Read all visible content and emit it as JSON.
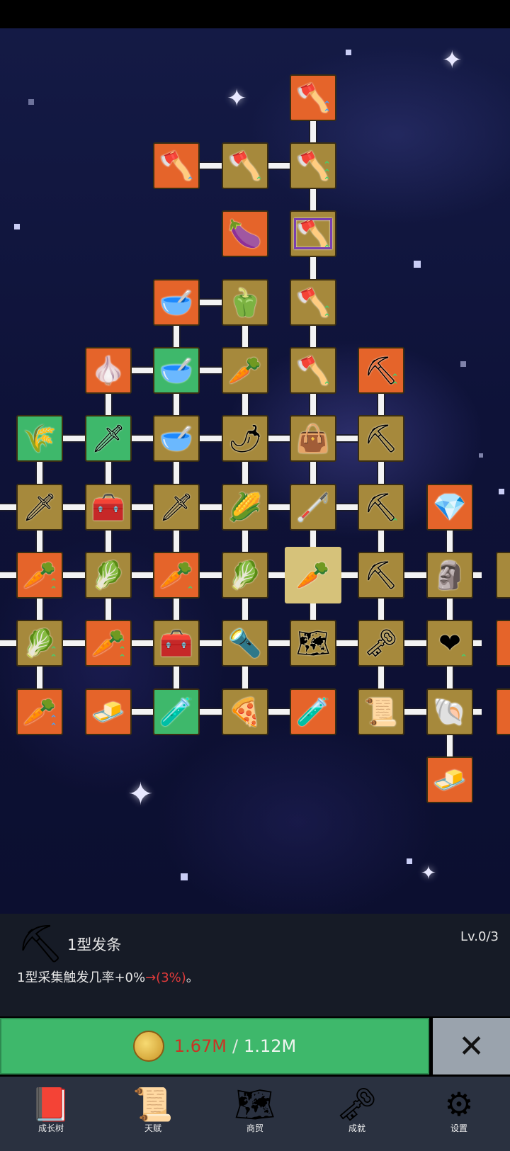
{
  "selected": {
    "icon": "pickaxe-icon",
    "name": "1型发条",
    "level": "Lv.0/3",
    "desc_prefix": "1型采集触发几率+0%",
    "desc_next": "→(3%)",
    "desc_suffix": "。"
  },
  "upgrade": {
    "current": "1.67M",
    "separator": "/",
    "required": "1.12M",
    "coin_icon": "gold-coin-icon"
  },
  "close_label": "✕",
  "nav": [
    {
      "label": "成长树",
      "icon": "book-icon",
      "glyph": "📕"
    },
    {
      "label": "天赋",
      "icon": "scroll-icon",
      "glyph": "📜"
    },
    {
      "label": "商贸",
      "icon": "map-icon",
      "glyph": "🗺"
    },
    {
      "label": "成就",
      "icon": "key-icon",
      "glyph": "🗝"
    },
    {
      "label": "设置",
      "icon": "gear-icon",
      "glyph": "⚙"
    }
  ],
  "colors": {
    "gold_tile": "#a6893c",
    "orange_tile": "#e5642a",
    "green_tile": "#3eb86b",
    "button_green": "#3eb86b",
    "warning_red": "#e23b3b"
  },
  "tree": [
    {
      "id": "shovel-top",
      "icon": "shovel-icon",
      "glyph": "🪓",
      "style": "orange",
      "up": "^^",
      "upColor": "blue"
    },
    {
      "id": "shovel-left",
      "icon": "shovel-icon",
      "glyph": "🪓",
      "style": "orange",
      "up": "^",
      "upColor": "blue"
    },
    {
      "id": "shovel-red",
      "icon": "shovel-icon",
      "glyph": "🪓",
      "style": "gold",
      "up": "^",
      "upColor": "green"
    },
    {
      "id": "shovel-mid",
      "icon": "shovel-icon",
      "glyph": "🪓",
      "style": "gold",
      "up": "^^^",
      "upColor": "green"
    },
    {
      "id": "eggplant",
      "icon": "eggplant-icon",
      "glyph": "🍆",
      "style": "orange"
    },
    {
      "id": "shovel-purple",
      "icon": "shovel-icon",
      "glyph": "🪓",
      "style": "purple",
      "up": "^",
      "upColor": "green"
    },
    {
      "id": "bowl-1",
      "icon": "bowl-icon",
      "glyph": "🥣",
      "style": "orange"
    },
    {
      "id": "pepper-green",
      "icon": "bell-pepper-icon",
      "glyph": "🫑",
      "style": "gold"
    },
    {
      "id": "shovel-4",
      "icon": "shovel-icon",
      "glyph": "🪓",
      "style": "gold",
      "up": "^^",
      "upColor": "green"
    },
    {
      "id": "garlic",
      "icon": "garlic-icon",
      "glyph": "🧄",
      "style": "orange"
    },
    {
      "id": "bowl-2",
      "icon": "bowl-icon",
      "glyph": "🥣",
      "style": "green"
    },
    {
      "id": "radish",
      "icon": "radish-icon",
      "glyph": "🥕",
      "style": "gold"
    },
    {
      "id": "shovel-5",
      "icon": "shovel-icon",
      "glyph": "🪓",
      "style": "gold",
      "up": "^",
      "upColor": "green"
    },
    {
      "id": "pickaxe-1",
      "icon": "pickaxe-icon",
      "glyph": "⛏",
      "style": "orange",
      "up": "^^",
      "upColor": "green"
    },
    {
      "id": "hay",
      "icon": "hay-bale-icon",
      "glyph": "🌾",
      "style": "green"
    },
    {
      "id": "sword-1",
      "icon": "sword-icon",
      "glyph": "🗡",
      "style": "green"
    },
    {
      "id": "bowl-3",
      "icon": "bowl-icon",
      "glyph": "🥣",
      "style": "gold"
    },
    {
      "id": "chili",
      "icon": "chili-icon",
      "glyph": "🌶",
      "style": "gold"
    },
    {
      "id": "sack",
      "icon": "sack-icon",
      "glyph": "👜",
      "style": "gold"
    },
    {
      "id": "pickaxe-2",
      "icon": "pickaxe-icon",
      "glyph": "⛏",
      "style": "gold"
    },
    {
      "id": "sword-2",
      "icon": "sword-icon",
      "glyph": "🗡",
      "style": "gold"
    },
    {
      "id": "chest-1",
      "icon": "chest-icon",
      "glyph": "🧰",
      "style": "gold"
    },
    {
      "id": "sword-3",
      "icon": "sword-icon",
      "glyph": "🗡",
      "style": "gold"
    },
    {
      "id": "corn",
      "icon": "corn-icon",
      "glyph": "🌽",
      "style": "gold"
    },
    {
      "id": "staff",
      "icon": "staff-icon",
      "glyph": "🦯",
      "style": "gold"
    },
    {
      "id": "pickaxe-3",
      "icon": "pickaxe-icon",
      "glyph": "⛏",
      "style": "gold",
      "up": "^",
      "upColor": "green"
    },
    {
      "id": "crystal",
      "icon": "crystal-icon",
      "glyph": "💎",
      "style": "orange"
    },
    {
      "id": "carrot-1",
      "icon": "carrot-icon",
      "glyph": "🥕",
      "style": "orange",
      "up": "^^",
      "upColor": "green"
    },
    {
      "id": "cabbage-1",
      "icon": "cabbage-icon",
      "glyph": "🥬",
      "style": "gold"
    },
    {
      "id": "carrot-2",
      "icon": "carrot-icon",
      "glyph": "🥕",
      "style": "orange",
      "up": "^",
      "upColor": "green"
    },
    {
      "id": "cabbage-2",
      "icon": "cabbage-icon",
      "glyph": "🥬",
      "style": "gold"
    },
    {
      "id": "carrot-center",
      "icon": "carrot-icon",
      "glyph": "🥕",
      "style": "sel"
    },
    {
      "id": "pickaxe-4",
      "icon": "pickaxe-icon",
      "glyph": "⛏",
      "style": "gold"
    },
    {
      "id": "statue",
      "icon": "statue-icon",
      "glyph": "🗿",
      "style": "gold"
    },
    {
      "id": "cut-1",
      "icon": "statue-icon",
      "glyph": "",
      "style": "gold"
    },
    {
      "id": "cabbage-3",
      "icon": "cabbage-icon",
      "glyph": "🥬",
      "style": "gold",
      "up": "^^",
      "upColor": "green"
    },
    {
      "id": "carrot-3",
      "icon": "carrot-icon",
      "glyph": "🥕",
      "style": "orange",
      "up": "^^^",
      "upColor": "green"
    },
    {
      "id": "chest-2",
      "icon": "treasure-chest-icon",
      "glyph": "🧰",
      "style": "gold"
    },
    {
      "id": "torch",
      "icon": "torch-icon",
      "glyph": "🔦",
      "style": "gold"
    },
    {
      "id": "map",
      "icon": "map-icon",
      "glyph": "🗺",
      "style": "gold"
    },
    {
      "id": "key",
      "icon": "key-icon",
      "glyph": "🗝",
      "style": "gold"
    },
    {
      "id": "heart",
      "icon": "heart-icon",
      "glyph": "❤",
      "style": "gold",
      "up": "^",
      "upColor": "green"
    },
    {
      "id": "cut-2",
      "icon": "carrot-icon",
      "glyph": "",
      "style": "orange"
    },
    {
      "id": "carrot-4",
      "icon": "carrot-icon",
      "glyph": "🥕",
      "style": "orange",
      "up": "^^",
      "upColor": "blue"
    },
    {
      "id": "gold-bar",
      "icon": "gold-bar-icon",
      "glyph": "🧈",
      "style": "orange"
    },
    {
      "id": "potion-1",
      "icon": "potion-icon",
      "glyph": "🧪",
      "style": "green"
    },
    {
      "id": "pizza",
      "icon": "pizza-icon",
      "glyph": "🍕",
      "style": "gold"
    },
    {
      "id": "potion-2",
      "icon": "potion-icon",
      "glyph": "🧪",
      "style": "orange"
    },
    {
      "id": "scroll",
      "icon": "scroll-icon",
      "glyph": "📜",
      "style": "gold"
    },
    {
      "id": "fossil",
      "icon": "fossil-icon",
      "glyph": "🐚",
      "style": "gold"
    },
    {
      "id": "cut-3",
      "icon": "unknown-icon",
      "glyph": "",
      "style": "orange"
    },
    {
      "id": "butter",
      "icon": "butter-icon",
      "glyph": "🧈",
      "style": "orange"
    }
  ]
}
